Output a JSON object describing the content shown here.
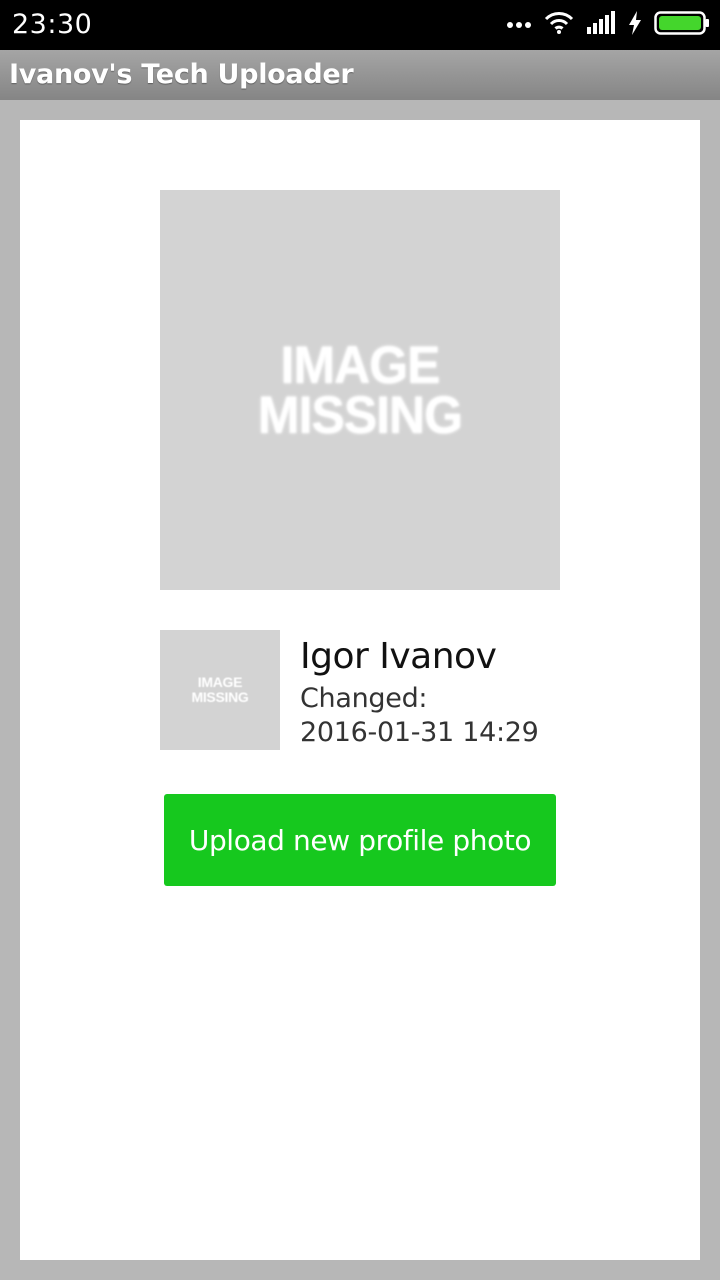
{
  "status_bar": {
    "time": "23:30",
    "icons": [
      "more-dots-icon",
      "wifi-icon",
      "signal-icon",
      "charging-bolt-icon",
      "battery-icon"
    ],
    "battery_color": "#44d62c"
  },
  "app_bar": {
    "title": "Ivanov's Tech Uploader"
  },
  "profile": {
    "large_photo": {
      "line1": "IMAGE",
      "line2": "MISSING"
    },
    "thumbnail": {
      "line1": "IMAGE",
      "line2": "MISSING"
    },
    "name": "Igor Ivanov",
    "changed_label": "Changed:",
    "changed_value": "2016-01-31 14:29"
  },
  "actions": {
    "upload_label": "Upload new profile photo",
    "upload_color": "#16c81e"
  }
}
